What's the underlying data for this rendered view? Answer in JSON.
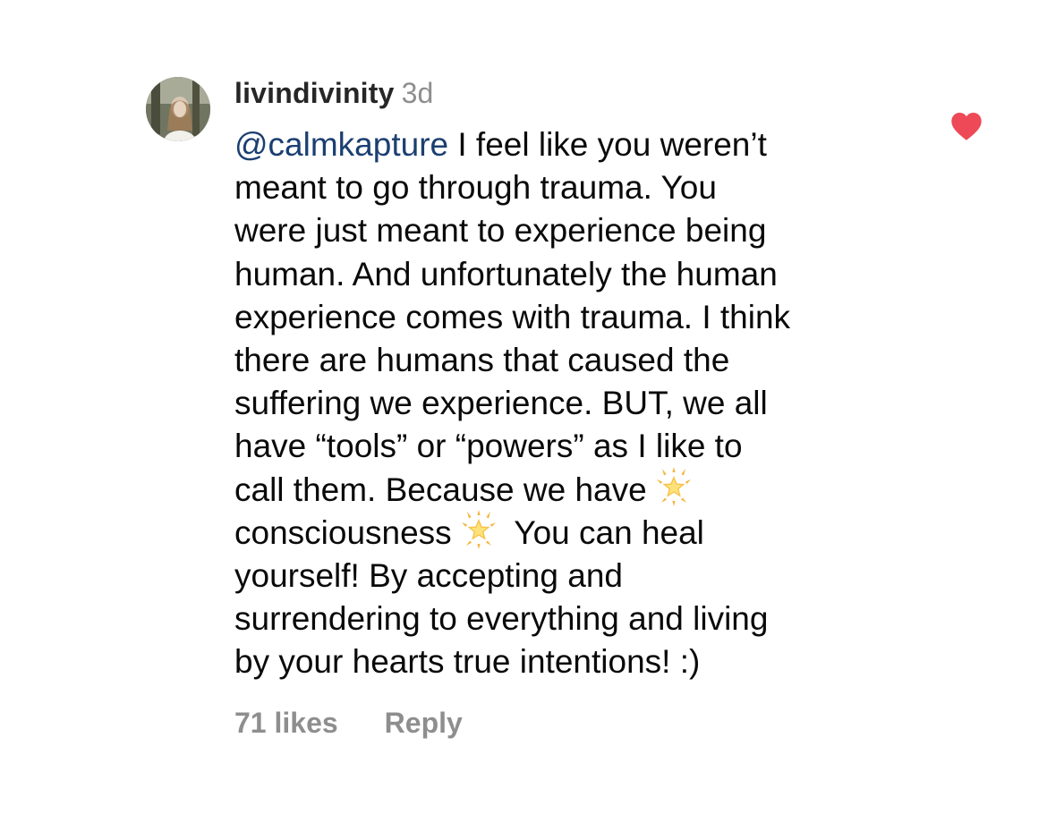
{
  "comment": {
    "username": "livindivinity",
    "time_ago": "3d",
    "mention": "@calmkapture",
    "text_part1": " I feel like you weren’t\nmeant to go through trauma. You\nwere just meant to experience being\nhuman. And unfortunately the human\nexperience comes with trauma. I think\nthere are humans that caused the\nsuffering we experience. BUT, we all\nhave “tools” or “powers” as I like to\ncall them. Because we have",
    "text_part2": "\nconsciousness",
    "text_part3": " You can heal\nyourself! By accepting and\nsurrendering to everything and living\nby your hearts true intentions! :)",
    "emoji_name": "glowing-star-icon",
    "likes": "71 likes",
    "reply_label": "Reply",
    "liked": true,
    "heart_color": "#ed4956",
    "mention_color": "#1b3f71",
    "meta_color": "#8e8e8e"
  }
}
